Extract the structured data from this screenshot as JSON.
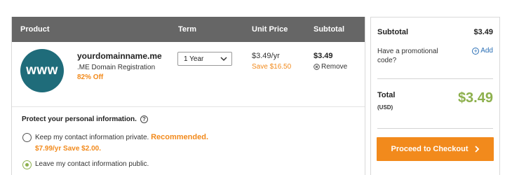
{
  "cart": {
    "headers": {
      "product": "Product",
      "term": "Term",
      "unit_price": "Unit Price",
      "subtotal": "Subtotal"
    },
    "item": {
      "logo_text": "www",
      "domain_name": "yourdomainname.me",
      "domain_type": ".ME Domain Registration",
      "discount": "82% Off",
      "term_value": "1 Year",
      "unit_price": "$3.49/yr",
      "savings": "Save $16.50",
      "subtotal": "$3.49",
      "remove_label": "Remove"
    },
    "privacy": {
      "heading": "Protect your personal information.",
      "option_private_text": "Keep my contact information private.",
      "option_private_recommended": "Recommended.",
      "option_private_price": "$7.99/yr Save $2.00.",
      "option_public_text": "Leave my contact information public.",
      "selected": "public"
    }
  },
  "summary": {
    "subtotal_label": "Subtotal",
    "subtotal_value": "$3.49",
    "promo_label": "Have a promotional code?",
    "add_label": "Add",
    "total_label": "Total",
    "currency": "(USD)",
    "total_value": "$3.49",
    "checkout_label": "Proceed to Checkout"
  },
  "colors": {
    "header_bg": "#666666",
    "accent_orange": "#f28a1c",
    "total_green": "#8db04d",
    "logo_teal": "#1f6c7a",
    "link_blue": "#2a6fb5"
  },
  "icons": {
    "dropdown": "chevron-down-icon",
    "remove": "close-circle-icon",
    "help": "question-circle-icon",
    "add": "plus-circle-icon",
    "checkout_arrow": "chevron-right-icon"
  }
}
